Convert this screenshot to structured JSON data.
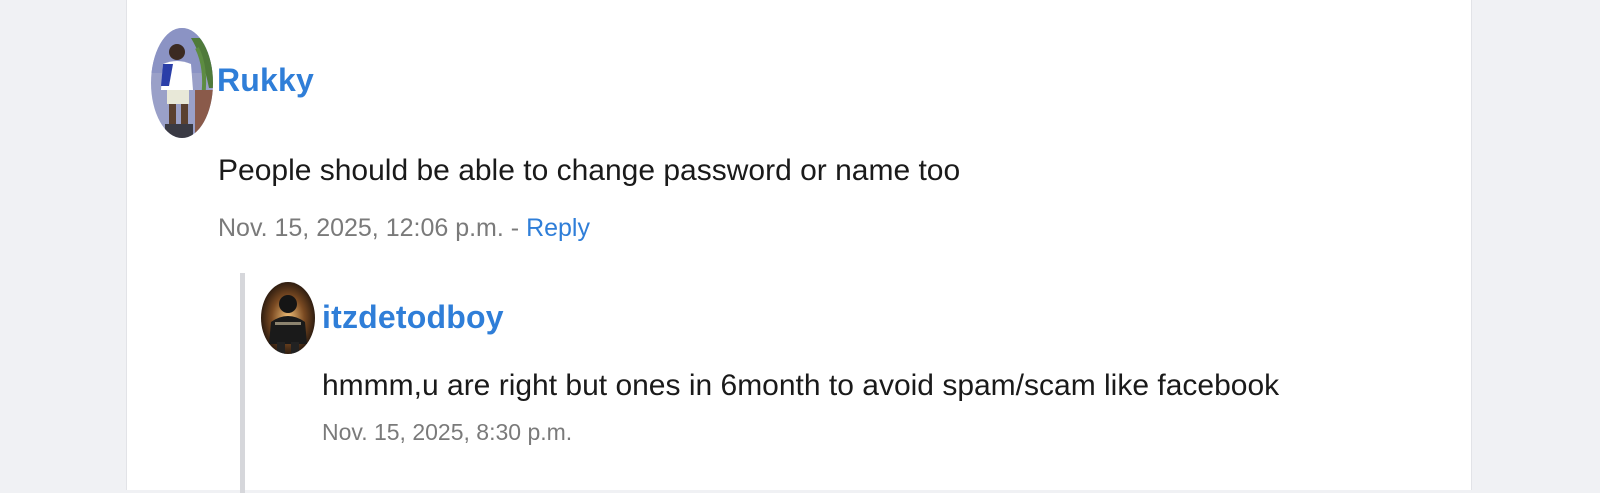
{
  "comments": [
    {
      "author": "Rukky",
      "text": "People should be able to change password or name too",
      "timestamp": "Nov. 15, 2025, 12:06 p.m.",
      "separator": "-",
      "reply_label": "Reply",
      "avatar_icon": "user-avatar-photo",
      "replies": [
        {
          "author": "itzdetodboy",
          "text": "hmmm,u are right but ones in 6month to avoid spam/scam like facebook",
          "timestamp": "Nov. 15, 2025, 8:30 p.m.",
          "avatar_icon": "user-avatar-photo"
        }
      ]
    }
  ],
  "colors": {
    "link": "#2f7ed8",
    "meta": "#7a7a7a",
    "text": "#1a1a1a",
    "thread_line": "#d6d7db",
    "page_bg": "#f0f1f4"
  }
}
